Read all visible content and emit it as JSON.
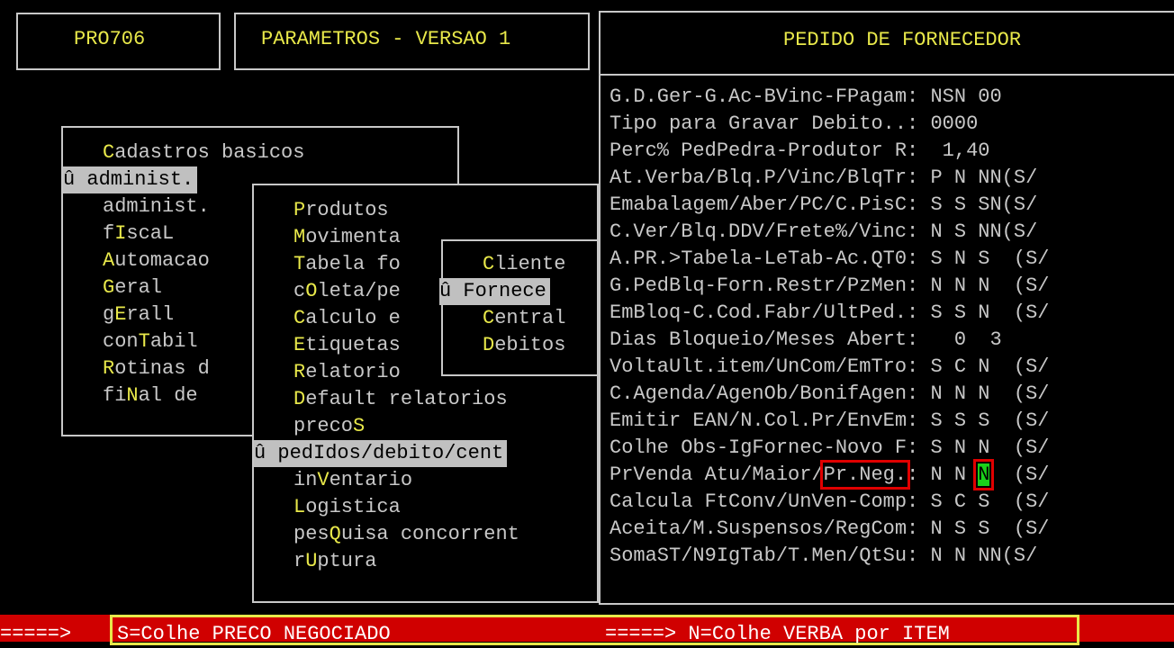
{
  "header": {
    "program_code": "PRO706",
    "window_title": "PARAMETROS - VERSAO 1",
    "panel_title": "PEDIDO DE FORNECEDOR"
  },
  "menu_main": {
    "items": [
      {
        "pre": "",
        "hk": "C",
        "post": "adastros basicos"
      },
      {
        "pre": "û administ.",
        "hk": "",
        "post": ""
      },
      {
        "pre": "administ.",
        "hk": "",
        "post": ""
      },
      {
        "pre": "f",
        "hk": "I",
        "post": "scaL"
      },
      {
        "pre": "",
        "hk": "A",
        "post": "utomacao"
      },
      {
        "pre": "",
        "hk": "G",
        "post": "eral"
      },
      {
        "pre": "g",
        "hk": "E",
        "post": "rall"
      },
      {
        "pre": "con",
        "hk": "T",
        "post": "abil"
      },
      {
        "pre": "",
        "hk": "R",
        "post": "otinas d"
      },
      {
        "pre": "fi",
        "hk": "N",
        "post": "al de"
      }
    ]
  },
  "menu_admin": {
    "items": [
      {
        "pre": "",
        "hk": "P",
        "post": "rodutos"
      },
      {
        "pre": "",
        "hk": "M",
        "post": "ovimenta"
      },
      {
        "pre": "",
        "hk": "T",
        "post": "abela fo"
      },
      {
        "pre": "c",
        "hk": "O",
        "post": "leta/pe"
      },
      {
        "pre": "",
        "hk": "C",
        "post": "alculo e"
      },
      {
        "pre": "",
        "hk": "E",
        "post": "tiquetas"
      },
      {
        "pre": "",
        "hk": "R",
        "post": "elatorio"
      },
      {
        "pre": "",
        "hk": "D",
        "post": "efault relatorios"
      },
      {
        "pre": "preco",
        "hk": "S",
        "post": ""
      },
      {
        "pre": "û pedIdos/debito/cent",
        "hk": "",
        "post": ""
      },
      {
        "pre": "in",
        "hk": "V",
        "post": "entario"
      },
      {
        "pre": "",
        "hk": "L",
        "post": "ogistica"
      },
      {
        "pre": "pes",
        "hk": "Q",
        "post": "uisa concorrent"
      },
      {
        "pre": "r",
        "hk": "U",
        "post": "ptura"
      }
    ]
  },
  "menu_pedidos": {
    "items": [
      {
        "pre": "",
        "hk": "C",
        "post": "liente"
      },
      {
        "pre": "û Fornece",
        "hk": "",
        "post": ""
      },
      {
        "pre": "",
        "hk": "C",
        "post": "entral"
      },
      {
        "pre": "",
        "hk": "D",
        "post": "ebitos"
      }
    ]
  },
  "params": {
    "rows": [
      {
        "label": "G.D.Ger-G.Ac-BVinc-FPagam:",
        "value": " NSN 00"
      },
      {
        "label": "Tipo para Gravar Debito..:",
        "value": " 0000"
      },
      {
        "label": "Perc% PedPedra-Produtor R:",
        "value": "  1,40"
      },
      {
        "label": "At.Verba/Blq.P/Vinc/BlqTr:",
        "value": " P N NN(S/"
      },
      {
        "label": "Emabalagem/Aber/PC/C.PisC:",
        "value": " S S SN(S/"
      },
      {
        "label": "C.Ver/Blq.DDV/Frete%/Vinc:",
        "value": " N S NN(S/"
      },
      {
        "label": "A.PR.>Tabela-LeTab-Ac.QT0:",
        "value": " S N S  (S/"
      },
      {
        "label": "G.PedBlq-Forn.Restr/PzMen:",
        "value": " N N N  (S/"
      },
      {
        "label": "EmBloq-C.Cod.Fabr/UltPed.:",
        "value": " S S N  (S/"
      },
      {
        "label": "Dias Bloqueio/Meses Abert:",
        "value": "   0  3"
      },
      {
        "label": "VoltaUlt.item/UnCom/EmTro:",
        "value": " S C N  (S/"
      },
      {
        "label": "C.Agenda/AgenOb/BonifAgen:",
        "value": " N N N  (S/"
      },
      {
        "label": "Emitir EAN/N.Col.Pr/EnvEm:",
        "value": " S S S  (S/"
      },
      {
        "label": "Colhe Obs-IgFornec-Novo F:",
        "value": " S N N  (S/"
      },
      {
        "label": "PrVenda Atu/Maior/Pr.Neg.:",
        "value": " N N N  (S/"
      },
      {
        "label": "Calcula FtConv/UnVen-Comp:",
        "value": " S C S  (S/"
      },
      {
        "label": "Aceita/M.Suspensos/RegCom:",
        "value": " N S S  (S/"
      },
      {
        "label": "SomaST/N9IgTab/T.Men/QtSu:",
        "value": " N N NN(S/"
      }
    ],
    "highlight_row": {
      "prefix": "PrVenda Atu/Maior/",
      "highlighted_label": "Pr.Neg.",
      "colon": ":",
      "v1": " N N ",
      "active_value": "N",
      "suffix": "  (S/"
    }
  },
  "status_bar": {
    "arrow_left": "=====>",
    "help_left": "S=Colhe PRECO NEGOCIADO",
    "help_right": "=====> N=Colhe VERBA por ITEM"
  },
  "colors": {
    "background": "#000000",
    "text": "#c8c8c8",
    "hotkey": "#e8e84a",
    "status_bar": "#d00000",
    "active_value": "#1ad01a",
    "annotation": "#e00000"
  }
}
